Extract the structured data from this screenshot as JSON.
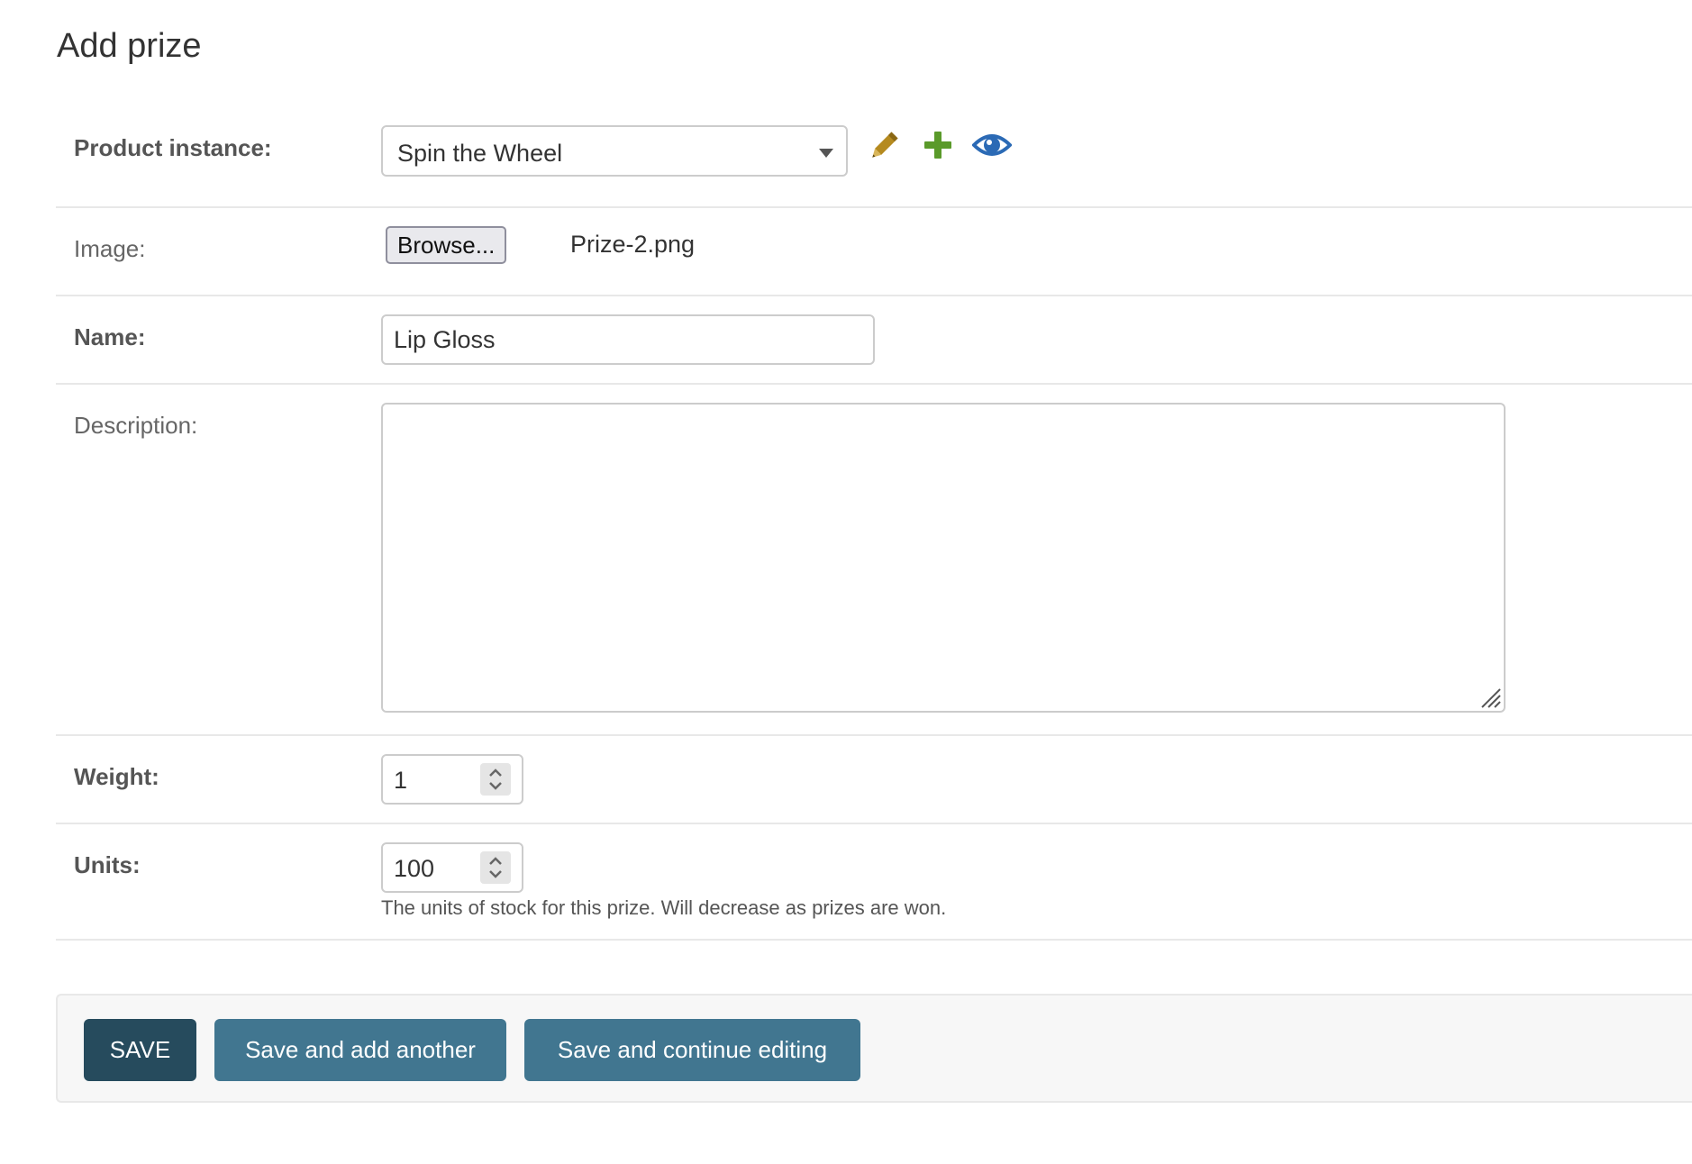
{
  "page": {
    "title": "Add prize"
  },
  "fields": {
    "product_instance": {
      "label": "Product instance:",
      "value": "Spin the Wheel",
      "icons": {
        "change": "pencil-icon",
        "add": "plus-icon",
        "view": "eye-icon"
      }
    },
    "image": {
      "label": "Image:",
      "browse_label": "Browse...",
      "file_name": "Prize-2.png"
    },
    "name": {
      "label": "Name:",
      "value": "Lip Gloss"
    },
    "description": {
      "label": "Description:",
      "value": ""
    },
    "weight": {
      "label": "Weight:",
      "value": "1"
    },
    "units": {
      "label": "Units:",
      "value": "100",
      "help_text": "The units of stock for this prize. Will decrease as prizes are won."
    }
  },
  "actions": {
    "save": "SAVE",
    "save_add_another": "Save and add another",
    "save_continue": "Save and continue editing"
  },
  "colors": {
    "pencil": "#b58a1f",
    "plus": "#5a9a2a",
    "eye": "#2b6ab5",
    "save_button": "#264b5d",
    "secondary_button": "#417690"
  }
}
